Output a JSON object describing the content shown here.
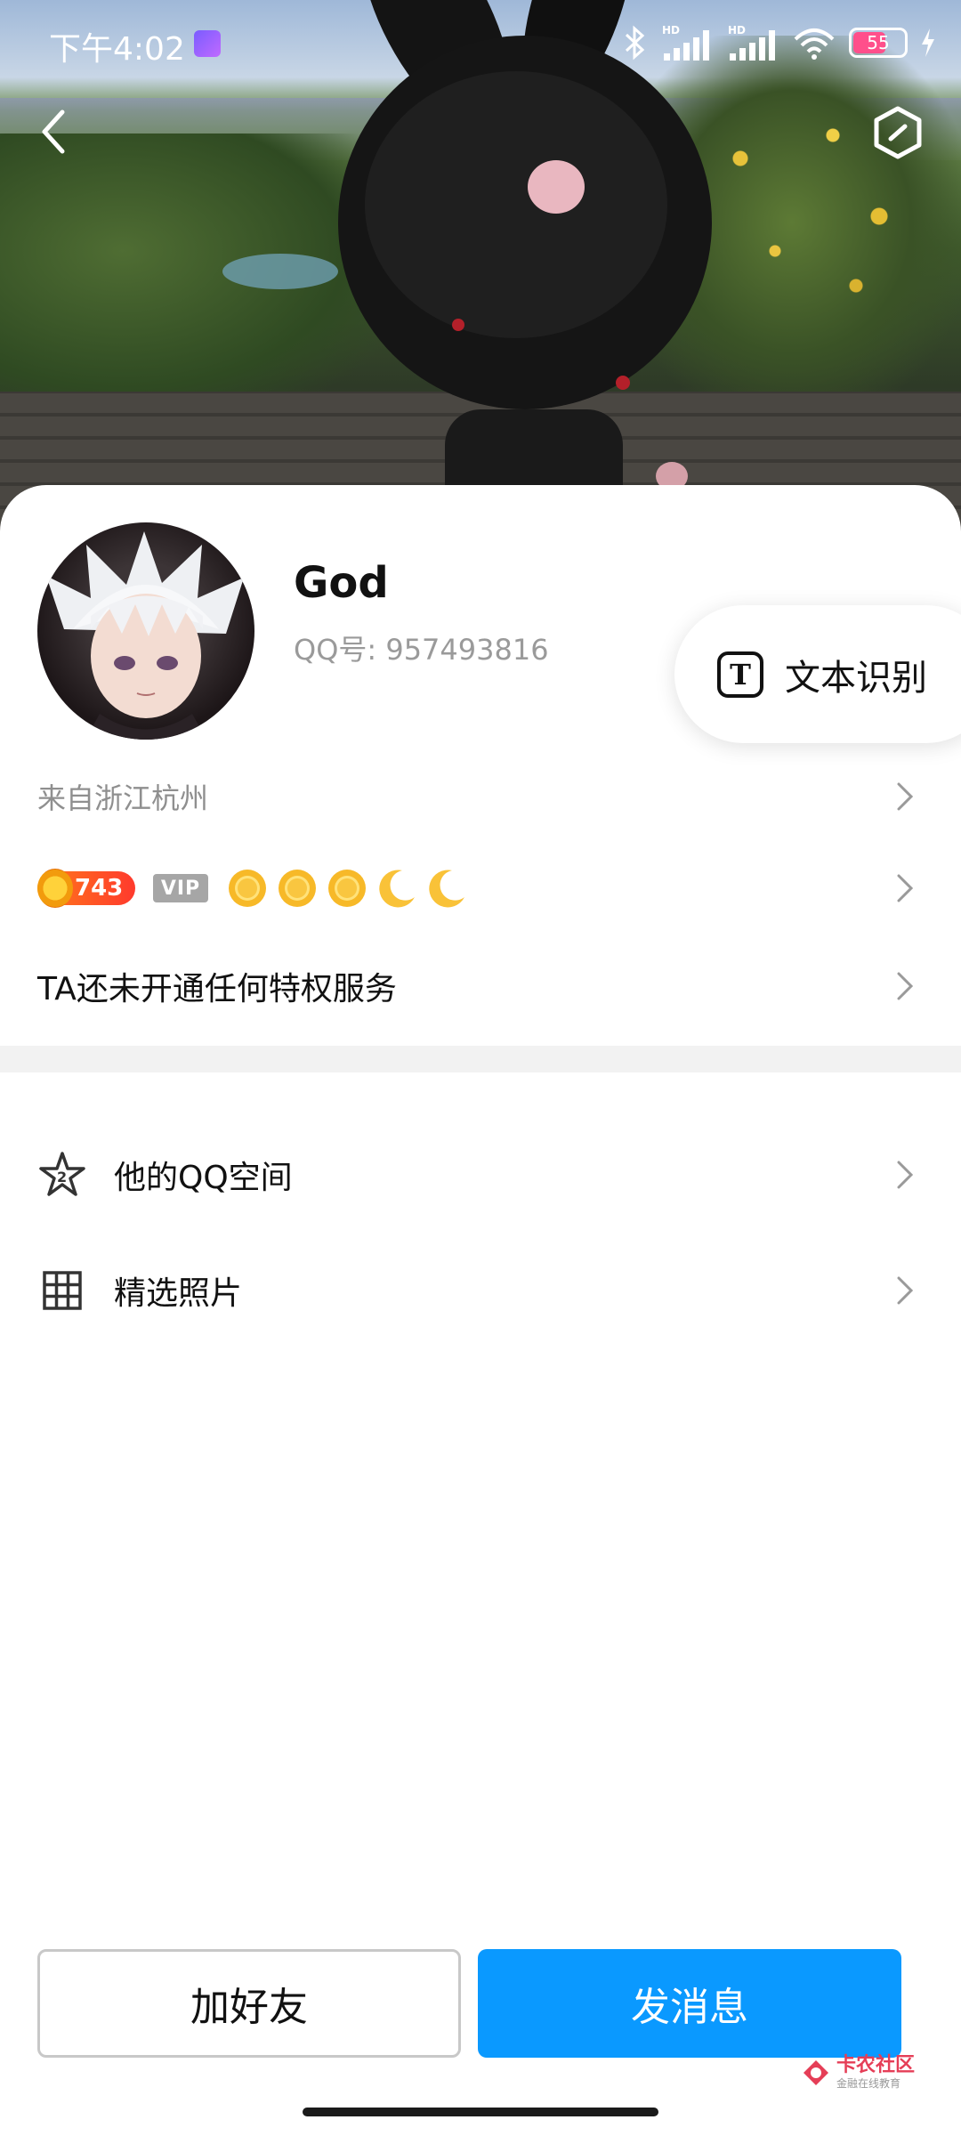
{
  "status_bar": {
    "time": "下午4:02",
    "network_labels": [
      "HD",
      "HD"
    ],
    "battery": "55"
  },
  "profile": {
    "nickname": "God",
    "qq_id": "QQ号: 957493816",
    "location": "来自浙江杭州",
    "coin_count": "743",
    "vip_label": "VIP",
    "level_icons": [
      "sun-icon",
      "sun-icon",
      "sun-icon",
      "moon-icon",
      "moon-icon"
    ],
    "privilege_text": "TA还未开通任何特权服务"
  },
  "ocr": {
    "label": "文本识别",
    "icon_letter": "T"
  },
  "menu": [
    {
      "label": "他的QQ空间",
      "icon": "qzone-star-icon"
    },
    {
      "label": "精选照片",
      "icon": "photo-grid-icon"
    }
  ],
  "buttons": {
    "add_friend": "加好友",
    "send_message": "发消息"
  },
  "watermark": {
    "title": "卡农社区",
    "subtitle": "金融在线教育"
  },
  "colors": {
    "accent": "#0a99ff",
    "coin": "#ff5a1f",
    "vip_gray": "#a6a6a6"
  }
}
